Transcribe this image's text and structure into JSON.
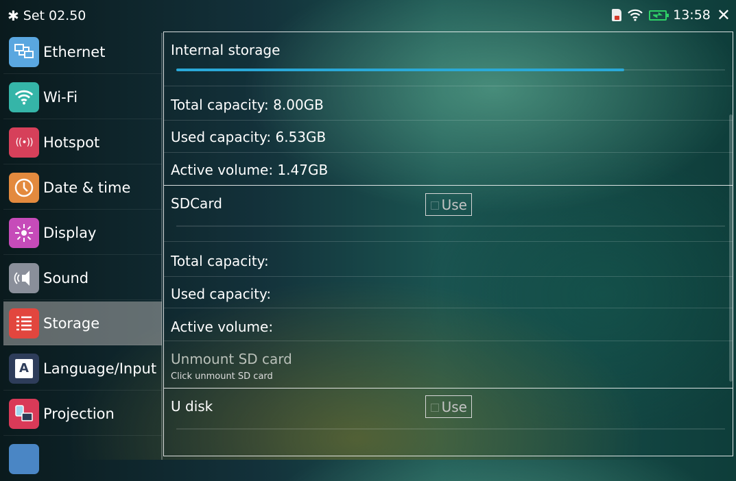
{
  "status_bar": {
    "title": "Set 02.50",
    "time": "13:58",
    "icons": [
      "gear-icon",
      "sd-card-icon",
      "wifi-icon",
      "battery-charging-icon",
      "close-icon"
    ]
  },
  "sidebar": {
    "items": [
      {
        "label": "Ethernet",
        "icon": "ethernet-icon",
        "color": "#5aa7e0"
      },
      {
        "label": "Wi-Fi",
        "icon": "wifi-icon",
        "color": "#35b5a8"
      },
      {
        "label": "Hotspot",
        "icon": "hotspot-icon",
        "color": "#d6405a"
      },
      {
        "label": "Date & time",
        "icon": "clock-icon",
        "color": "#e38a3e"
      },
      {
        "label": "Display",
        "icon": "display-icon",
        "color": "#c64bb9"
      },
      {
        "label": "Sound",
        "icon": "sound-icon",
        "color": "#8a8f9a"
      },
      {
        "label": "Storage",
        "icon": "storage-icon",
        "color": "#e2463e",
        "selected": true
      },
      {
        "label": "Language/Input",
        "icon": "language-icon",
        "color": "#2e3d5a"
      },
      {
        "label": "Projection",
        "icon": "projection-icon",
        "color": "#d93a58"
      }
    ]
  },
  "storage": {
    "internal": {
      "title": "Internal storage",
      "usage_fraction": 0.816,
      "total": "Total capacity: 8.00GB",
      "used": "Used capacity: 6.53GB",
      "active": "Active volume: 1.47GB"
    },
    "sdcard": {
      "title": "SDCard",
      "use_label": "Use",
      "total": "Total capacity:",
      "used": "Used capacity:",
      "active": "Active volume:",
      "unmount_title": "Unmount SD card",
      "unmount_subtitle": "Click unmount SD card"
    },
    "udisk": {
      "title": "U disk",
      "use_label": "Use"
    }
  }
}
